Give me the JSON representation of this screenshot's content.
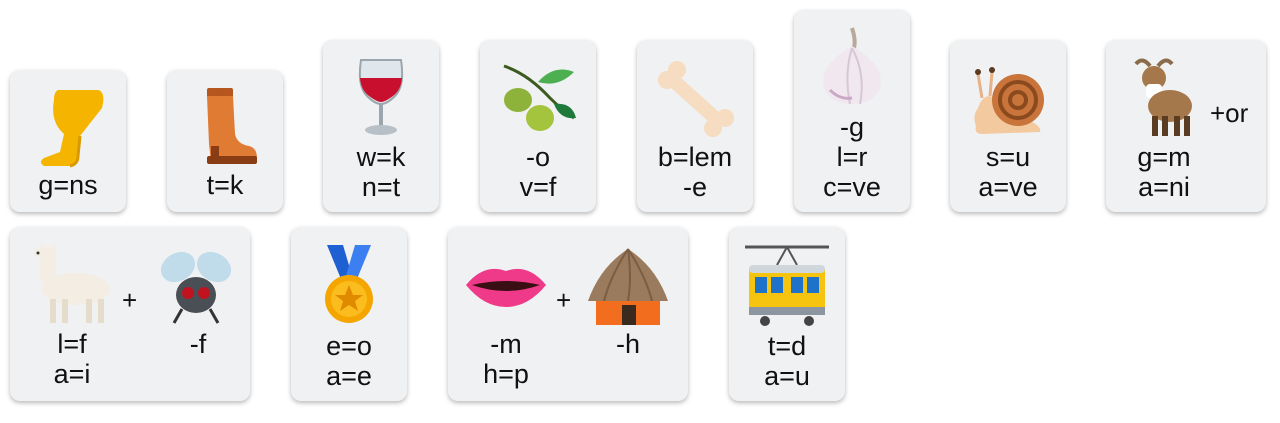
{
  "row1": [
    {
      "icon": "leg-icon",
      "clues": [
        "g=ns"
      ]
    },
    {
      "icon": "boot-icon",
      "clues": [
        "t=k"
      ]
    },
    {
      "icon": "wine-glass-icon",
      "clues": [
        "w=k",
        "n=t"
      ]
    },
    {
      "icon": "olive-icon",
      "clues": [
        "-o",
        "v=f"
      ]
    },
    {
      "icon": "bone-icon",
      "clues": [
        "b=lem",
        "-e"
      ]
    },
    {
      "icon": "garlic-icon",
      "clues": [
        "-g",
        "l=r",
        "c=ve"
      ]
    },
    {
      "icon": "snail-icon",
      "clues": [
        "s=u",
        "a=ve"
      ]
    },
    {
      "icon": "goat-icon",
      "clues": [
        "g=m",
        "a=ni"
      ],
      "extra": "+or"
    }
  ],
  "row2": [
    {
      "parts": [
        {
          "icon": "llama-icon",
          "clues": [
            "l=f",
            "a=i"
          ]
        },
        {
          "icon": "fly-icon",
          "clues": [
            "-f"
          ]
        }
      ],
      "operator": "+"
    },
    {
      "icon": "medal-icon",
      "clues": [
        "e=o",
        "a=e"
      ]
    },
    {
      "parts": [
        {
          "icon": "mouth-icon",
          "clues": [
            "-m",
            "h=p"
          ]
        },
        {
          "icon": "hut-icon",
          "clues": [
            "-h"
          ]
        }
      ],
      "operator": "+"
    },
    {
      "icon": "tram-icon",
      "clues": [
        "t=d",
        "a=u"
      ]
    }
  ]
}
